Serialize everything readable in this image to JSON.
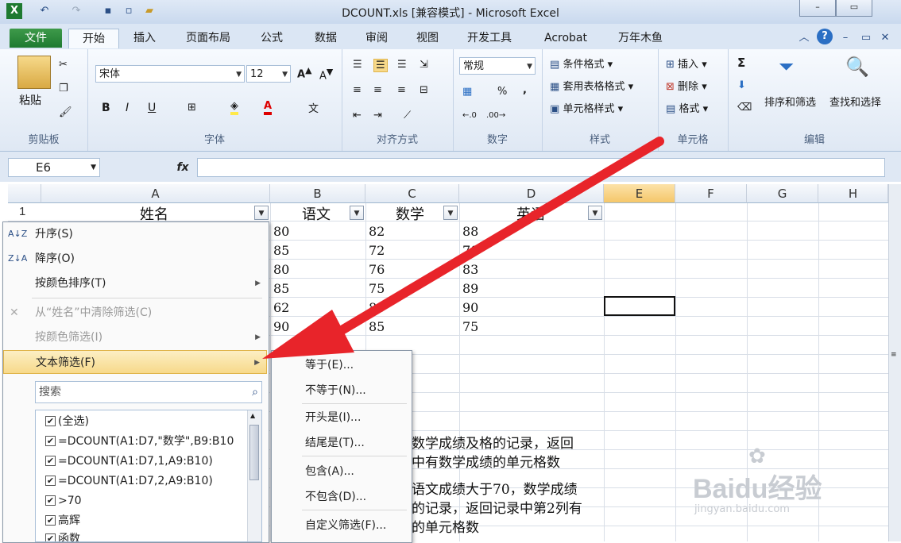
{
  "window": {
    "title": "DCOUNT.xls  [兼容模式] - Microsoft Excel",
    "icons": [
      "excel-icon",
      "undo-icon",
      "redo-icon",
      "save-icon",
      "new-icon",
      "open-icon"
    ]
  },
  "tabs": [
    {
      "label": "文件"
    },
    {
      "label": "开始"
    },
    {
      "label": "插入"
    },
    {
      "label": "页面布局"
    },
    {
      "label": "公式"
    },
    {
      "label": "数据"
    },
    {
      "label": "审阅"
    },
    {
      "label": "视图"
    },
    {
      "label": "开发工具"
    },
    {
      "label": "Acrobat"
    },
    {
      "label": "万年木鱼"
    }
  ],
  "ribbon": {
    "clipboard": {
      "label": "剪贴板",
      "paste": "粘贴"
    },
    "font": {
      "label": "字体",
      "name": "宋体",
      "size": "12",
      "bold": "B",
      "italic": "I",
      "underline": "U"
    },
    "alignment": {
      "label": "对齐方式"
    },
    "number": {
      "label": "数字",
      "format": "常规",
      "percent": "%",
      "comma": ","
    },
    "styles": {
      "label": "样式",
      "cond": "条件格式",
      "table": "套用表格格式",
      "cell": "单元格样式"
    },
    "cells": {
      "label": "单元格",
      "insert": "插入",
      "delete": "删除",
      "format": "格式"
    },
    "editing": {
      "label": "编辑",
      "sort": "排序和筛选",
      "find": "查找和选择",
      "sigma": "Σ"
    }
  },
  "formula_bar": {
    "name_box": "E6",
    "fx": "fx",
    "content": ""
  },
  "columns": [
    "A",
    "B",
    "C",
    "D",
    "E",
    "F",
    "G",
    "H"
  ],
  "row1": {
    "row": "1",
    "A": "姓名",
    "B": "语文",
    "C": "数学",
    "D": "英语"
  },
  "data_rows": [
    {
      "B": "80",
      "C": "82",
      "D": "88"
    },
    {
      "B": "85",
      "C": "72",
      "D": "70"
    },
    {
      "B": "80",
      "C": "76",
      "D": "83"
    },
    {
      "B": "85",
      "C": "75",
      "D": "89"
    },
    {
      "B": "62",
      "C": "86",
      "D": "90"
    },
    {
      "B": "90",
      "C": "85",
      "D": "75"
    }
  ],
  "notes": [
    "数学成绩及格的记录，返回",
    "中有数学成绩的单元格数",
    "语文成绩大于70，数学成绩",
    "的记录，返回记录中第2列有",
    "的单元格数"
  ],
  "filter_menu": {
    "items": [
      {
        "label": "升序(S)",
        "icon": "sort-asc-icon"
      },
      {
        "label": "降序(O)",
        "icon": "sort-desc-icon"
      },
      {
        "label": "按颜色排序(T)"
      },
      {
        "label": "从“姓名”中清除筛选(C)",
        "icon": "clear-filter-icon"
      },
      {
        "label": "按颜色筛选(I)"
      },
      {
        "label": "文本筛选(F)"
      }
    ],
    "search_placeholder": "搜索",
    "list": [
      "(全选)",
      "=DCOUNT(A1:D7,\"数学\",B9:B10",
      "=DCOUNT(A1:D7,1,A9:B10)",
      "=DCOUNT(A1:D7,2,A9:B10)",
      ">70",
      "高辉",
      "函数"
    ]
  },
  "text_filter_submenu": [
    "等于(E)...",
    "不等于(N)...",
    "开头是(I)...",
    "结尾是(T)...",
    "包含(A)...",
    "不包含(D)...",
    "自定义筛选(F)..."
  ],
  "watermark": {
    "text": "Baidu经验",
    "sub": "jingyan.baidu.com"
  },
  "colors": {
    "accent": "#1e7a30",
    "highlight": "#f7d98a",
    "arrow": "#e8242a"
  }
}
